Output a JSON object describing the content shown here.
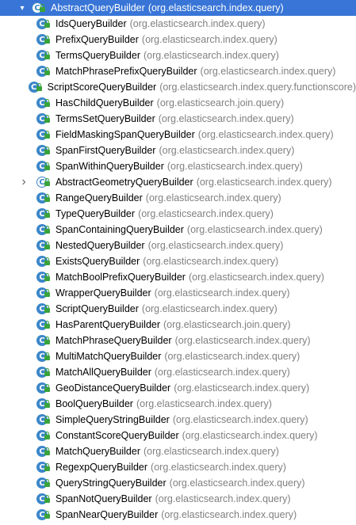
{
  "root": {
    "name": "AbstractQueryBuilder",
    "pkg": "(org.elasticsearch.index.query)",
    "toggle_icon": "chevron-down-icon"
  },
  "items": [
    {
      "name": "IdsQueryBuilder",
      "pkg": "(org.elasticsearch.index.query)"
    },
    {
      "name": "PrefixQueryBuilder",
      "pkg": "(org.elasticsearch.index.query)"
    },
    {
      "name": "TermsQueryBuilder",
      "pkg": "(org.elasticsearch.index.query)"
    },
    {
      "name": "MatchPhrasePrefixQueryBuilder",
      "pkg": "(org.elasticsearch.index.query)"
    },
    {
      "name": "ScriptScoreQueryBuilder",
      "pkg": "(org.elasticsearch.index.query.functionscore)"
    },
    {
      "name": "HasChildQueryBuilder",
      "pkg": "(org.elasticsearch.join.query)"
    },
    {
      "name": "TermsSetQueryBuilder",
      "pkg": "(org.elasticsearch.index.query)"
    },
    {
      "name": "FieldMaskingSpanQueryBuilder",
      "pkg": "(org.elasticsearch.index.query)"
    },
    {
      "name": "SpanFirstQueryBuilder",
      "pkg": "(org.elasticsearch.index.query)"
    },
    {
      "name": "SpanWithinQueryBuilder",
      "pkg": "(org.elasticsearch.index.query)"
    },
    {
      "name": "AbstractGeometryQueryBuilder",
      "pkg": "(org.elasticsearch.index.query)"
    },
    {
      "name": "RangeQueryBuilder",
      "pkg": "(org.elasticsearch.index.query)"
    },
    {
      "name": "TypeQueryBuilder",
      "pkg": "(org.elasticsearch.index.query)"
    },
    {
      "name": "SpanContainingQueryBuilder",
      "pkg": "(org.elasticsearch.index.query)"
    },
    {
      "name": "NestedQueryBuilder",
      "pkg": "(org.elasticsearch.index.query)"
    },
    {
      "name": "ExistsQueryBuilder",
      "pkg": "(org.elasticsearch.index.query)"
    },
    {
      "name": "MatchBoolPrefixQueryBuilder",
      "pkg": "(org.elasticsearch.index.query)"
    },
    {
      "name": "WrapperQueryBuilder",
      "pkg": "(org.elasticsearch.index.query)"
    },
    {
      "name": "ScriptQueryBuilder",
      "pkg": "(org.elasticsearch.index.query)"
    },
    {
      "name": "HasParentQueryBuilder",
      "pkg": "(org.elasticsearch.join.query)"
    },
    {
      "name": "MatchPhraseQueryBuilder",
      "pkg": "(org.elasticsearch.index.query)"
    },
    {
      "name": "MultiMatchQueryBuilder",
      "pkg": "(org.elasticsearch.index.query)"
    },
    {
      "name": "MatchAllQueryBuilder",
      "pkg": "(org.elasticsearch.index.query)"
    },
    {
      "name": "GeoDistanceQueryBuilder",
      "pkg": "(org.elasticsearch.index.query)"
    },
    {
      "name": "BoolQueryBuilder",
      "pkg": "(org.elasticsearch.index.query)"
    },
    {
      "name": "SimpleQueryStringBuilder",
      "pkg": "(org.elasticsearch.index.query)"
    },
    {
      "name": "ConstantScoreQueryBuilder",
      "pkg": "(org.elasticsearch.index.query)"
    },
    {
      "name": "MatchQueryBuilder",
      "pkg": "(org.elasticsearch.index.query)"
    },
    {
      "name": "RegexpQueryBuilder",
      "pkg": "(org.elasticsearch.index.query)"
    },
    {
      "name": "QueryStringQueryBuilder",
      "pkg": "(org.elasticsearch.index.query)"
    },
    {
      "name": "SpanNotQueryBuilder",
      "pkg": "(org.elasticsearch.index.query)"
    },
    {
      "name": "SpanNearQueryBuilder",
      "pkg": "(org.elasticsearch.index.query)"
    }
  ],
  "colors": {
    "selection": "#3875d7",
    "class_icon": "#3c87c9",
    "lock": "#39a33b",
    "package_text": "#808080"
  },
  "icons": {
    "class": "class-icon",
    "abstract_class": "abstract-class-icon",
    "visibility": "lock-icon",
    "collapsed": "chevron-right-icon",
    "expanded": "chevron-down-icon"
  }
}
